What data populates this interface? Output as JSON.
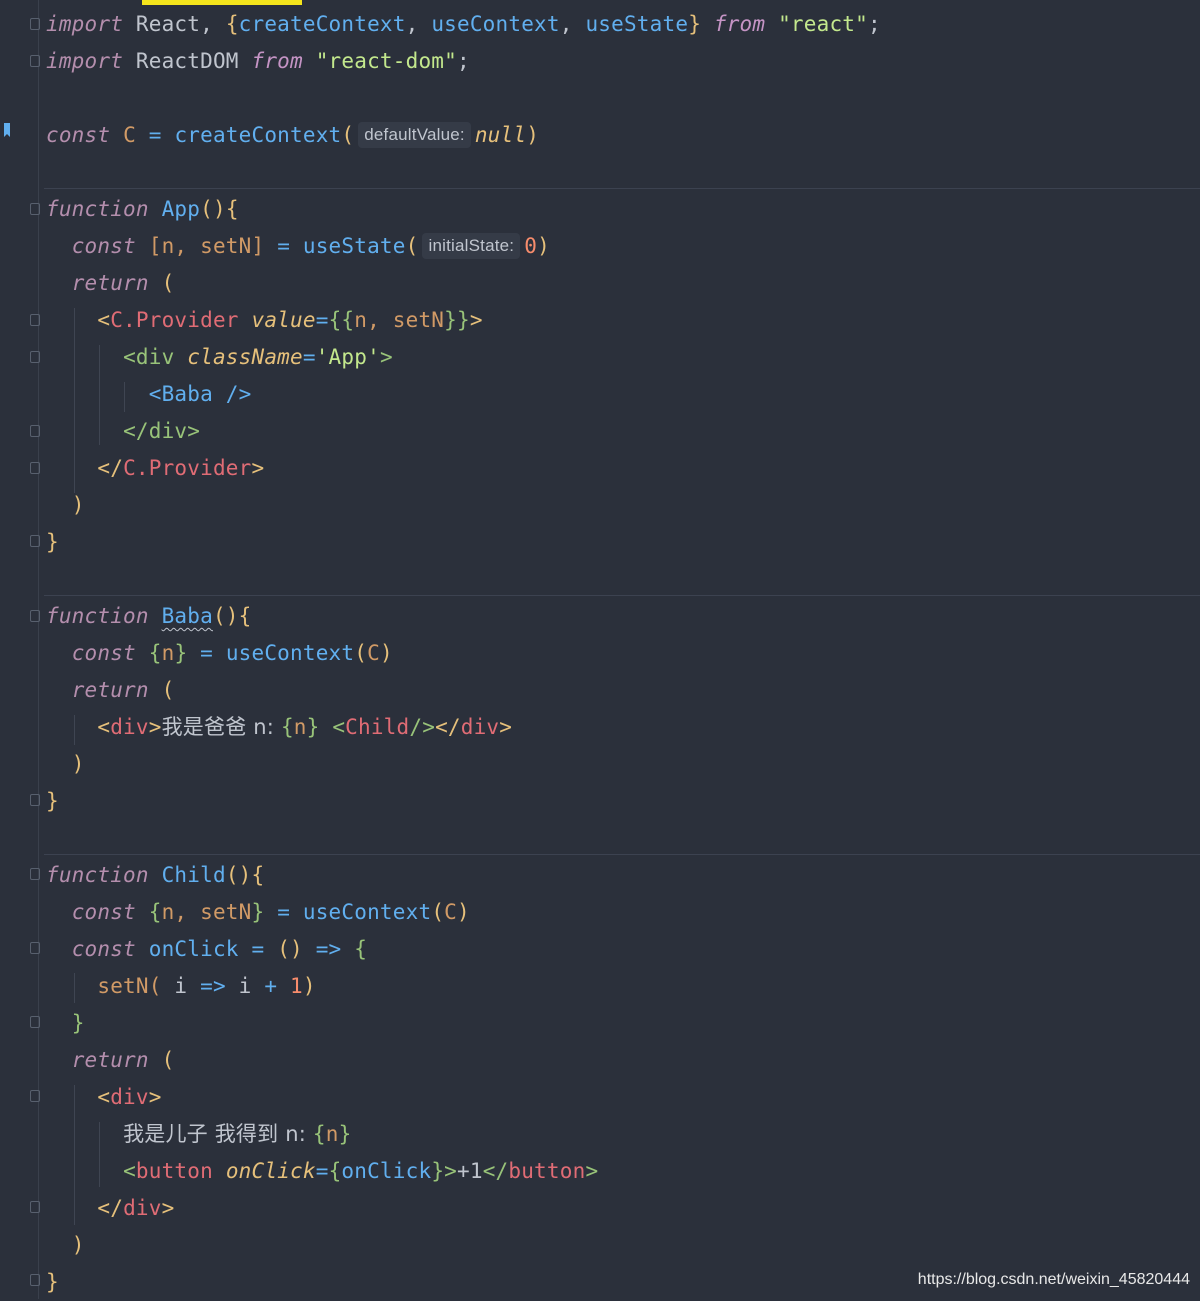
{
  "code_lines": {
    "l1": {
      "import": "import",
      "react": "React,",
      "ob": "{",
      "createContext": "createContext",
      "c1": ",",
      "useContext": "useContext",
      "c2": ",",
      "useState": "useState",
      "cb": "}",
      "from": "from",
      "str": "\"react\"",
      "semi": ";"
    },
    "l2": {
      "import": "import",
      "reactdom": "ReactDOM",
      "from": "from",
      "str": "\"react-dom\"",
      "semi": ";"
    },
    "l4": {
      "const": "const",
      "c": "C",
      "eq": "=",
      "fn": "createContext",
      "op": "(",
      "hint": "defaultValue:",
      "null": "null",
      "cp": ")"
    },
    "l6": {
      "function": "function",
      "name": "App",
      "parens": "()",
      "brace": "{"
    },
    "l7": {
      "const": "const",
      "destr": "[n, setN]",
      "eq": "=",
      "fn": "useState",
      "op": "(",
      "hint": "initialState:",
      "zero": "0",
      "cp": ")"
    },
    "l8": {
      "return": "return",
      "paren": "("
    },
    "l9": {
      "lt": "<",
      "tag": "C.Provider",
      "attr": "value",
      "eq": "=",
      "ob": "{{",
      "v": "n, setN",
      "cb": "}}",
      "gt": ">"
    },
    "l10": {
      "lt": "<",
      "tag": "div",
      "attr": "className",
      "eq": "=",
      "str": "'App'",
      "gt": ">"
    },
    "l11": {
      "lt": "<",
      "tag": "Baba",
      "close": " />"
    },
    "l12": {
      "lt": "</",
      "tag": "div",
      "gt": ">"
    },
    "l13": {
      "lt": "</",
      "tag": "C.Provider",
      "gt": ">"
    },
    "l14": {
      "paren": ")"
    },
    "l15": {
      "brace": "}"
    },
    "l17": {
      "function": "function",
      "name": "Baba",
      "parens": "()",
      "brace": "{"
    },
    "l18": {
      "const": "const",
      "ob": "{",
      "n": "n",
      "cb": "}",
      "eq": "=",
      "fn": "useContext",
      "op": "(",
      "c": "C",
      "cp": ")"
    },
    "l19": {
      "return": "return",
      "paren": "("
    },
    "l20": {
      "lt": "<",
      "tag": "div",
      "gt": ">",
      "text": "我是爸爸 n: ",
      "ob": "{",
      "n": "n",
      "cb": "}",
      "clt": "<",
      "child": "Child",
      "cgt": "/>",
      "elt": "</",
      "etag": "div",
      "egt": ">"
    },
    "l21": {
      "paren": ")"
    },
    "l22": {
      "brace": "}"
    },
    "l24": {
      "function": "function",
      "name": "Child",
      "parens": "()",
      "brace": "{"
    },
    "l25": {
      "const": "const",
      "ob": "{",
      "v": "n, setN",
      "cb": "}",
      "eq": "=",
      "fn": "useContext",
      "op": "(",
      "c": "C",
      "cp": ")"
    },
    "l26": {
      "const": "const",
      "name": "onClick",
      "eq": "=",
      "parens": "()",
      "arrow": "=>",
      "brace": "{"
    },
    "l27": {
      "fn": "setN(",
      "i1": " i ",
      "arrow": "=>",
      "rest": " i ",
      "plus": "+",
      "one": " 1",
      "cp": ")"
    },
    "l28": {
      "brace": "}"
    },
    "l29": {
      "return": "return",
      "paren": "("
    },
    "l30": {
      "lt": "<",
      "tag": "div",
      "gt": ">"
    },
    "l31": {
      "text": "我是儿子 我得到 n: ",
      "ob": "{",
      "n": "n",
      "cb": "}"
    },
    "l32": {
      "lt": "<",
      "tag": "button",
      "attr": "onClick",
      "eq": "=",
      "ob": "{",
      "v": "onClick",
      "cb": "}",
      "gt": ">",
      "text": "+1",
      "elt": "</",
      "etag": "button",
      "egt": ">"
    },
    "l33": {
      "lt": "</",
      "tag": "div",
      "gt": ">"
    },
    "l34": {
      "paren": ")"
    },
    "l35": {
      "brace": "}"
    }
  },
  "watermark": "https://blog.csdn.net/weixin_45820444",
  "colors": {
    "background": "#2b303b",
    "keyword": "#b48ead",
    "function": "#61afef",
    "string": "#c3e88d",
    "tag": "#e06c75",
    "bracket": "#e6c07b"
  }
}
